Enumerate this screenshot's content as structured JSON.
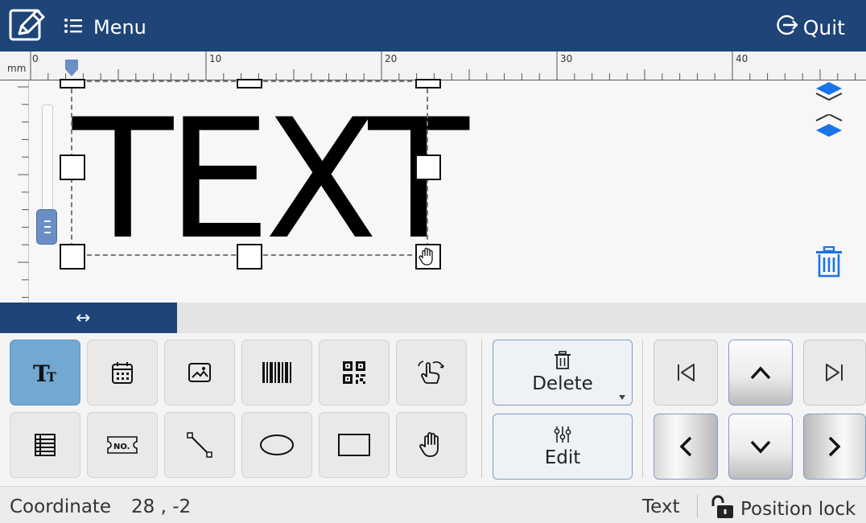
{
  "topbar": {
    "menu_label": "Menu",
    "quit_label": "Quit",
    "logo_icon": "edit-document-icon",
    "menu_icon": "list-icon",
    "quit_icon": "logout-arrow-icon",
    "color": "#1e4478"
  },
  "ruler": {
    "unit": "mm",
    "labels": [
      "0",
      "10",
      "20",
      "30",
      "40"
    ]
  },
  "canvas": {
    "object_text": "TEXT",
    "layer_up_icon": "layer-up-icon",
    "layer_down_icon": "layer-down-icon",
    "delete_icon": "trash-icon",
    "accent": "#1a73e8"
  },
  "expand_bar": {
    "icon_text": "↔"
  },
  "tools": {
    "row1": [
      "text-tool",
      "date-tool",
      "image-tool",
      "barcode-tool",
      "qrcode-tool",
      "gesture-tool"
    ],
    "row2": [
      "table-tool",
      "serial-number-tool",
      "line-tool",
      "ellipse-tool",
      "rectangle-tool",
      "hand-tool"
    ],
    "serial_label": "NO.",
    "active_color": "#72a8d1"
  },
  "actions": {
    "delete_label": "Delete",
    "edit_label": "Edit"
  },
  "status": {
    "coordinate_label": "Coordinate",
    "coordinate_value": "28 , -2",
    "object_type": "Text",
    "lock_label": "Position lock"
  }
}
